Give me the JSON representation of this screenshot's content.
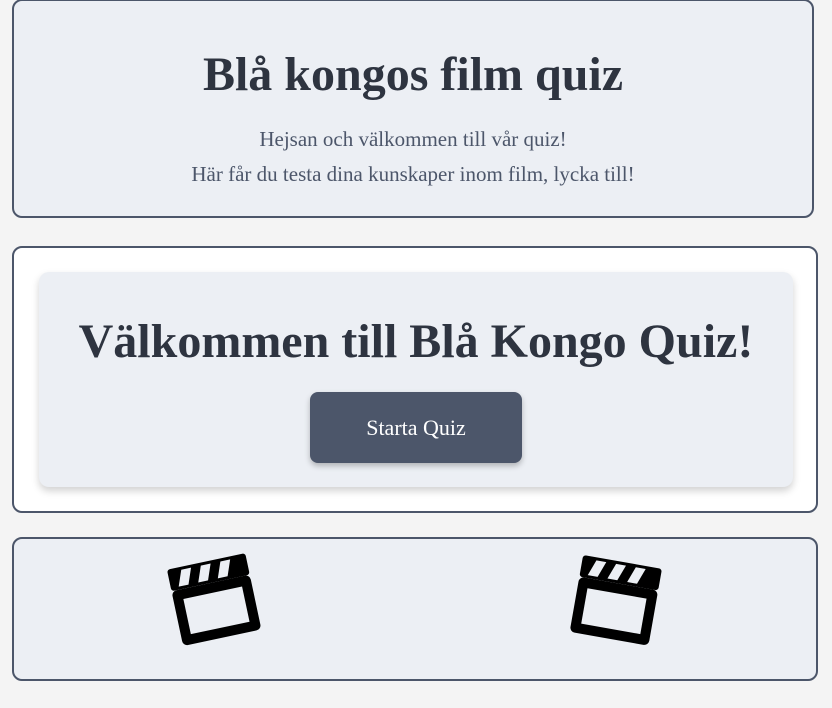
{
  "header": {
    "title": "Blå kongos film quiz",
    "line1": "Hejsan och välkommen till vår quiz!",
    "line2": "Här får du testa dina kunskaper inom film, lycka till!"
  },
  "welcome": {
    "title": "Välkommen till Blå Kongo Quiz!",
    "start_label": "Starta Quiz"
  },
  "footer": {
    "icons": [
      "clapperboard-icon",
      "clapperboard-icon"
    ]
  },
  "colors": {
    "page_background": "#f4f4f4",
    "box_background": "#eceff4",
    "border": "#4c566a",
    "button": "#4c566a",
    "title_text": "#2e3440"
  }
}
